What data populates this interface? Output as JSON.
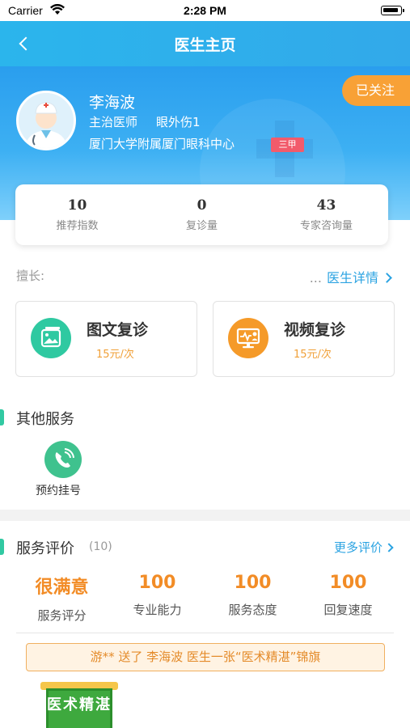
{
  "status_bar": {
    "carrier": "Carrier",
    "time": "2:28 PM"
  },
  "nav": {
    "title": "医生主页"
  },
  "doctor": {
    "name": "李海波",
    "title": "主治医师",
    "department": "眼外伤1",
    "hospital": "厦门大学附属厦门眼科中心",
    "hospital_grade": "三甲",
    "follow_label": "已关注"
  },
  "stats": [
    {
      "value": "10",
      "label": "推荐指数"
    },
    {
      "value": "0",
      "label": "复诊量"
    },
    {
      "value": "43",
      "label": "专家咨询量"
    }
  ],
  "expertise": {
    "label": "擅长:",
    "ellipsis": "...",
    "detail_link": "医生详情"
  },
  "consult": [
    {
      "name": "图文复诊",
      "price": "15元/次",
      "icon": "image-text-icon",
      "color": "#2fc9a1"
    },
    {
      "name": "视频复诊",
      "price": "15元/次",
      "icon": "video-consult-icon",
      "color": "#f59a29"
    }
  ],
  "other_services": {
    "title": "其他服务",
    "items": [
      {
        "label": "预约挂号",
        "icon": "phone-icon",
        "color": "#3fc28e"
      }
    ]
  },
  "evaluation": {
    "title": "服务评价",
    "count": "(10)",
    "more_link": "更多评价",
    "scores": [
      {
        "value": "很满意",
        "label": "服务评分"
      },
      {
        "value": "100",
        "label": "专业能力"
      },
      {
        "value": "100",
        "label": "服务态度"
      },
      {
        "value": "100",
        "label": "回复速度"
      }
    ],
    "banner": "游** 送了 李海波 医生一张“医术精湛”锦旗",
    "pennant_text": "医术精湛"
  },
  "colors": {
    "primary": "#2ba3e2",
    "accent_orange": "#f59a29",
    "accent_green": "#31c9a2"
  }
}
